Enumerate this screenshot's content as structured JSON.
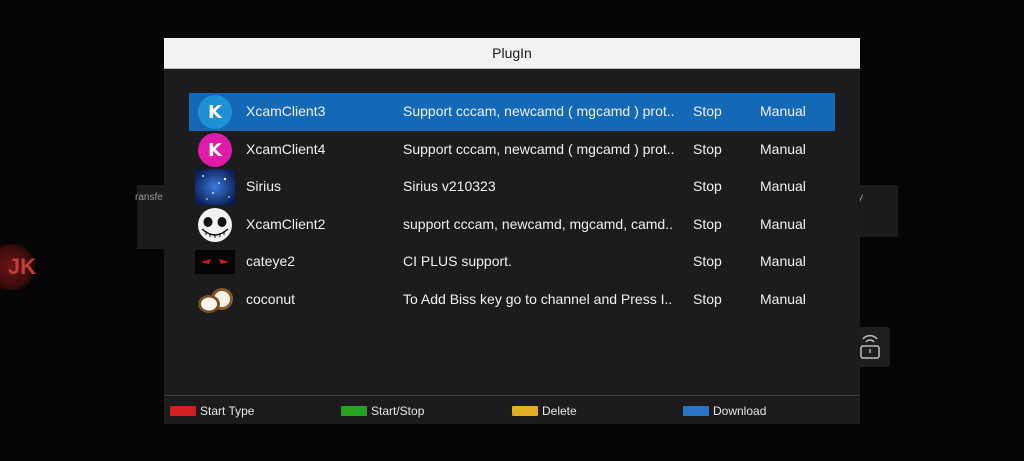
{
  "background": {
    "left_text": "ransfe",
    "right_text": "y",
    "logo_text": "JK"
  },
  "dialog": {
    "title": "PlugIn"
  },
  "plugins": [
    {
      "name": "XcamClient3",
      "description": "Support cccam, newcamd ( mgcamd ) prot..",
      "status": "Stop",
      "mode": "Manual",
      "icon": "xcam-blue-icon",
      "selected": true
    },
    {
      "name": "XcamClient4",
      "description": "Support cccam, newcamd ( mgcamd ) prot..",
      "status": "Stop",
      "mode": "Manual",
      "icon": "xcam-magenta-icon",
      "selected": false
    },
    {
      "name": "Sirius",
      "description": "Sirius v210323",
      "status": "Stop",
      "mode": "Manual",
      "icon": "sirius-starfield-icon",
      "selected": false
    },
    {
      "name": "XcamClient2",
      "description": "support cccam, newcamd, mgcamd, camd..",
      "status": "Stop",
      "mode": "Manual",
      "icon": "skull-face-icon",
      "selected": false
    },
    {
      "name": "cateye2",
      "description": "CI PLUS support.",
      "status": "Stop",
      "mode": "Manual",
      "icon": "cat-eyes-icon",
      "selected": false
    },
    {
      "name": "coconut",
      "description": "To Add Biss key go to channel and Press I..",
      "status": "Stop",
      "mode": "Manual",
      "icon": "coconut-icon",
      "selected": false
    }
  ],
  "footer": {
    "keys": [
      {
        "label": "Start Type",
        "color": "#d42020"
      },
      {
        "label": "Start/Stop",
        "color": "#22a322"
      },
      {
        "label": "Delete",
        "color": "#e1b020"
      },
      {
        "label": "Download",
        "color": "#2a72c8"
      }
    ]
  },
  "colors": {
    "selection": "#1469b7",
    "dialog_bg": "#1c1c1c",
    "title_bg": "#f2f2f2"
  }
}
